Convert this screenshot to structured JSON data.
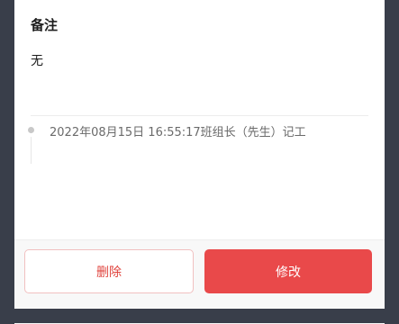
{
  "remark": {
    "title": "备注",
    "value": "无"
  },
  "log": {
    "entry": "2022年08月15日 16:55:17班组长（先生）记工"
  },
  "actions": {
    "delete_label": "删除",
    "edit_label": "修改"
  },
  "colors": {
    "accent": "#e9494a",
    "delete_text": "#e0433d",
    "background": "#393e4a"
  },
  "icons": {
    "timeline_dot": "timeline-dot-icon"
  }
}
